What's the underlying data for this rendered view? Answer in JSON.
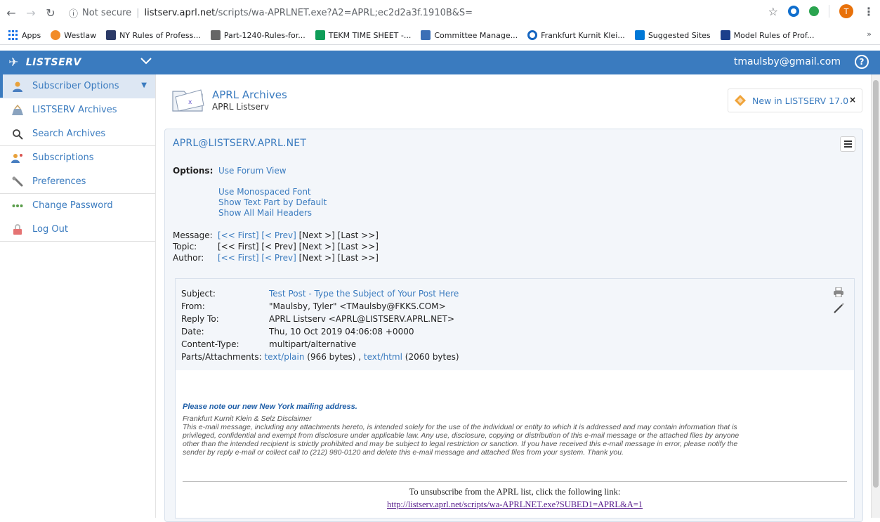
{
  "browser": {
    "omnibox": {
      "security_label": "Not secure",
      "separator": "|",
      "host": "listserv.aprl.net",
      "path": "/scripts/wa-APRLNET.exe?A2=APRL;ec2d2a3f.1910B&S="
    },
    "profile_initial": "T",
    "bookmarks": [
      {
        "label": "Apps",
        "color": "#1a73e8"
      },
      {
        "label": "Westlaw",
        "color": "#f28c28"
      },
      {
        "label": "NY Rules of Profess...",
        "color": "#2b3a67"
      },
      {
        "label": "Part-1240-Rules-for...",
        "color": "#555555"
      },
      {
        "label": "TEKM TIME SHEET -...",
        "color": "#0f9d58"
      },
      {
        "label": "Committee Manage...",
        "color": "#3b6fb6"
      },
      {
        "label": "Frankfurt Kurnit Klei...",
        "color": "#1565c0"
      },
      {
        "label": "Suggested Sites",
        "color": "#0078d7"
      },
      {
        "label": "Model Rules of Prof...",
        "color": "#1b3f8b"
      }
    ],
    "bookmarks_overflow": "»"
  },
  "topbar": {
    "brand": "LISTSERV",
    "user_email": "tmaulsby@gmail.com",
    "help_glyph": "?",
    "color": "#3a7bbf"
  },
  "sidebar": {
    "items": [
      {
        "label": "Subscriber Options",
        "icon": "user-icon"
      },
      {
        "label": "LISTSERV Archives",
        "icon": "archive-icon"
      },
      {
        "label": "Search Archives",
        "icon": "search-icon"
      },
      {
        "label": "Subscriptions",
        "icon": "subscriptions-icon"
      },
      {
        "label": "Preferences",
        "icon": "wrench-icon"
      },
      {
        "label": "Change Password",
        "icon": "password-icon"
      },
      {
        "label": "Log Out",
        "icon": "logout-icon"
      }
    ]
  },
  "header": {
    "title": "APRL Archives",
    "subtitle": "APRL Listserv",
    "news_label": "New in LISTSERV 17.0",
    "news_close": "×"
  },
  "panel": {
    "list_address": "APRL@LISTSERV.APRL.NET",
    "options_label": "Options:",
    "options": [
      "Use Forum View",
      "Use Monospaced Font",
      "Show Text Part by Default",
      "Show All Mail Headers"
    ],
    "navigation": [
      {
        "label": "Message:",
        "first": "[<< First]",
        "prev": "[< Prev]",
        "next": "[Next >]",
        "last": "[Last >>]"
      },
      {
        "label": "Topic:",
        "first": "[<< First]",
        "prev": "[< Prev]",
        "next": "[Next >]",
        "last": "[Last >>]"
      },
      {
        "label": "Author:",
        "first": "[<< First]",
        "prev": "[< Prev]",
        "next": "[Next >]",
        "last": "[Last >>]"
      }
    ]
  },
  "message": {
    "headers": {
      "subject_label": "Subject:",
      "subject": "Test Post - Type the Subject of Your Post Here",
      "from_label": "From:",
      "from": "\"Maulsby, Tyler\" <TMaulsby@FKKS.COM>",
      "reply_label": "Reply To:",
      "reply_to": "APRL Listserv <APRL@LISTSERV.APRL.NET>",
      "date_label": "Date:",
      "date": "Thu, 10 Oct 2019 04:06:08 +0000",
      "ctype_label": "Content-Type:",
      "content_type": "multipart/alternative",
      "parts_label": "Parts/Attachments:",
      "part1_link": "text/plain",
      "part1_size": "(966 bytes) ,",
      "part2_link": "text/html",
      "part2_size": "(2060 bytes)"
    },
    "body": {
      "notice": "Please note our new New York mailing address.",
      "disclaimer_title": "Frankfurt Kurnit Klein & Selz Disclaimer",
      "disclaimer_lines": [
        "This e-mail message, including any attachments hereto, is intended solely for the use of the individual or entity to which it is addressed and may contain information that is",
        "privileged, confidential and exempt from disclosure under applicable law. Any use, disclosure, copying or distribution of this e-mail message or the attached files by anyone",
        "other than the intended recipient is strictly prohibited and may be subject to legal restriction or sanction. If you have received this e-mail message in error, please notify the",
        "sender by reply e-mail or collect call to (212) 980-0120 and delete this e-mail message and attached files from your system. Thank you."
      ],
      "unsubscribe_text": "To unsubscribe from the APRL list, click the following link:",
      "unsubscribe_link": "http://listserv.aprl.net/scripts/wa-APRLNET.exe?SUBED1=APRL&A=1"
    }
  }
}
